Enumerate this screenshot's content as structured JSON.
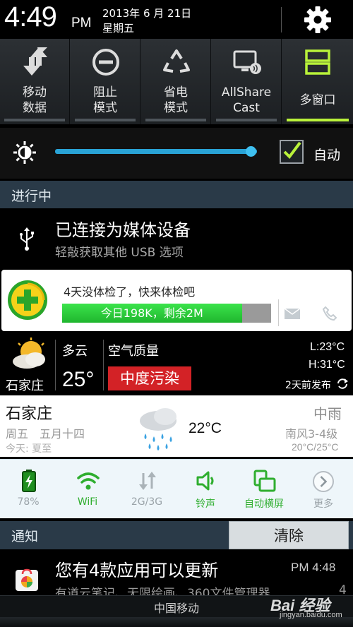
{
  "status_header": {
    "time": "4:49",
    "ampm": "PM",
    "date": "2013年 6 月 21日",
    "weekday": "星期五",
    "settings_icon": "gear-icon"
  },
  "quick_toggles": [
    {
      "line1": "移动",
      "line2": "数据",
      "icon": "mobile-data-icon",
      "active": false
    },
    {
      "line1": "阻止",
      "line2": "模式",
      "icon": "block-mode-icon",
      "active": false
    },
    {
      "line1": "省电",
      "line2": "模式",
      "icon": "recycle-icon",
      "active": false
    },
    {
      "line1": "AllShare",
      "line2": "Cast",
      "icon": "allshare-cast-icon",
      "active": false
    },
    {
      "line1": "多窗口",
      "line2": "",
      "icon": "multi-window-icon",
      "active": true
    }
  ],
  "brightness": {
    "level": 0.97,
    "auto_label": "自动",
    "auto_checked": true
  },
  "ongoing": {
    "header": "进行中",
    "usb_title": "已连接为媒体设备",
    "usb_subtitle": "轻敲获取其他 USB 选项"
  },
  "card_360": {
    "message": "4天没体检了，快来体检吧",
    "bar_text": "今日198K，剩余2M",
    "bar_fill": 0.86
  },
  "weather": {
    "city": "石家庄",
    "condition": "多云",
    "temp": "25°",
    "air_quality_label": "空气质量",
    "air_quality_value": "中度污染",
    "low": "L:23°C",
    "high": "H:31°C",
    "published": "2天前发布"
  },
  "weather2": {
    "city": "石家庄",
    "date": "周五　五月十四",
    "solar_term": "今天: 夏至",
    "temp": "22°C",
    "condition": "中雨",
    "wind": "南风3-4级",
    "range": "20°C/25°C"
  },
  "shortcuts": [
    {
      "label": "78%",
      "icon": "battery-icon",
      "color": "#9aa3a8"
    },
    {
      "label": "WiFi",
      "icon": "wifi-icon",
      "color": "#2fae2f"
    },
    {
      "label": "2G/3G",
      "icon": "data-arrows-icon",
      "color": "#9aa3a8"
    },
    {
      "label": "铃声",
      "icon": "ringer-icon",
      "color": "#2fae2f"
    },
    {
      "label": "自动横屏",
      "icon": "auto-rotate-icon",
      "color": "#2fae2f"
    },
    {
      "label": "更多",
      "icon": "chevron-right-icon",
      "color": "#9aa3a8"
    }
  ],
  "notifications": {
    "header": "通知",
    "clear_label": "清除",
    "update_title": "您有4款应用可以更新",
    "update_time": "PM 4:48",
    "update_subtitle": "有道云笔记、无限绘画、360文件管理器",
    "update_count": "4"
  },
  "carrier": "中国移动",
  "watermark": {
    "brand": "Bai 经验",
    "url": "jingyan.baidu.com"
  },
  "colors": {
    "accent_green": "#b9f23a",
    "slider_blue": "#29a3d6",
    "pollution_red": "#d32226",
    "section_header": "#2a3a48"
  }
}
